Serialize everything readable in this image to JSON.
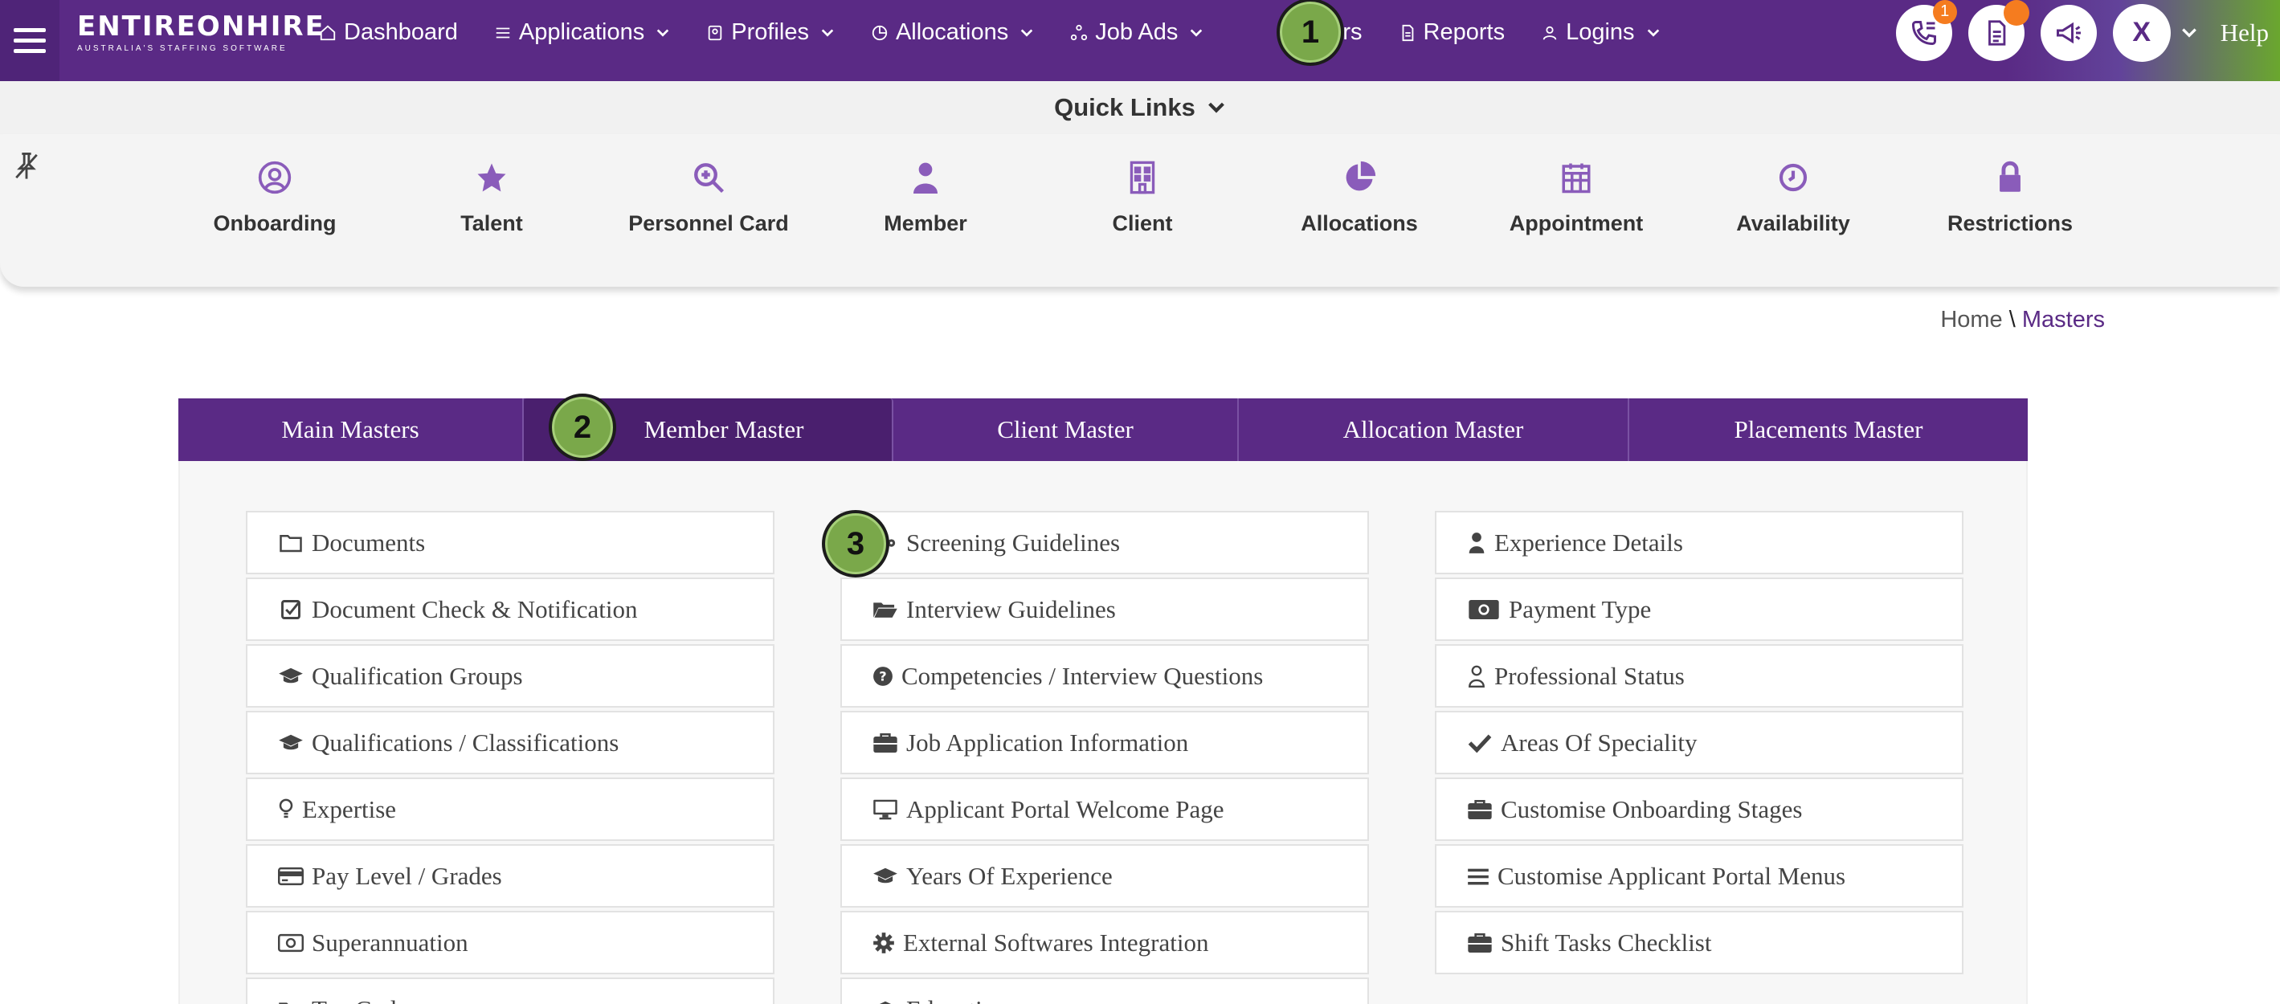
{
  "logo": {
    "brand": "ENTIREONHIRE",
    "tagline": "AUSTRALIA'S STAFFING SOFTWARE"
  },
  "nav": {
    "items": [
      {
        "label": "Dashboard",
        "icon": "home-icon"
      },
      {
        "label": "Applications",
        "icon": "list-icon"
      },
      {
        "label": "Profiles",
        "icon": "id-card-icon"
      },
      {
        "label": "Allocations",
        "icon": "pie-icon"
      },
      {
        "label": "Job Ads",
        "icon": "share-icon"
      },
      {
        "label": "Masters",
        "icon": "grid-icon"
      },
      {
        "label": "Reports",
        "icon": "file-icon"
      },
      {
        "label": "Logins",
        "icon": "user-icon"
      }
    ],
    "notification_count": "1",
    "user_initial": "X",
    "help": "Help"
  },
  "quick_links": {
    "title": "Quick Links",
    "items": [
      {
        "label": "Onboarding",
        "icon": "user-circle-icon"
      },
      {
        "label": "Talent",
        "icon": "star-icon"
      },
      {
        "label": "Personnel Card",
        "icon": "search-plus-icon"
      },
      {
        "label": "Member",
        "icon": "person-icon"
      },
      {
        "label": "Client",
        "icon": "building-icon"
      },
      {
        "label": "Allocations",
        "icon": "pie-chart-icon"
      },
      {
        "label": "Appointment",
        "icon": "calendar-icon"
      },
      {
        "label": "Availability",
        "icon": "clock-icon"
      },
      {
        "label": "Restrictions",
        "icon": "lock-icon"
      }
    ]
  },
  "breadcrumb": {
    "home": "Home",
    "separator": "\\",
    "current": "Masters"
  },
  "tabs": [
    "Main Masters",
    "Member Master",
    "Client Master",
    "Allocation Master",
    "Placements Master"
  ],
  "active_tab": "Member Master",
  "columns": [
    [
      {
        "label": "Documents",
        "icon": "folder-icon"
      },
      {
        "label": "Document Check & Notification",
        "icon": "check-square-icon"
      },
      {
        "label": "Qualification Groups",
        "icon": "graduation-cap-icon"
      },
      {
        "label": "Qualifications / Classifications",
        "icon": "graduation-cap-icon"
      },
      {
        "label": "Expertise",
        "icon": "lightbulb-icon"
      },
      {
        "label": "Pay Level / Grades",
        "icon": "credit-card-icon"
      },
      {
        "label": "Superannuation",
        "icon": "money-icon"
      },
      {
        "label": "Tax Codes",
        "icon": "folder-open-icon"
      }
    ],
    [
      {
        "label": "Screening Guidelines",
        "icon": "sitemap-icon"
      },
      {
        "label": "Interview Guidelines",
        "icon": "folder-open-icon"
      },
      {
        "label": "Competencies / Interview Questions",
        "icon": "question-circle-icon"
      },
      {
        "label": "Job Application Information",
        "icon": "briefcase-icon"
      },
      {
        "label": "Applicant Portal Welcome Page",
        "icon": "desktop-icon"
      },
      {
        "label": "Years Of Experience",
        "icon": "graduation-cap-icon"
      },
      {
        "label": "External Softwares Integration",
        "icon": "gear-icon"
      },
      {
        "label": "Education",
        "icon": "graduation-cap-icon"
      }
    ],
    [
      {
        "label": "Experience Details",
        "icon": "person-icon"
      },
      {
        "label": "Payment Type",
        "icon": "money-icon"
      },
      {
        "label": "Professional Status",
        "icon": "user-outline-icon"
      },
      {
        "label": "Areas Of Speciality",
        "icon": "check-icon"
      },
      {
        "label": "Customise Onboarding Stages",
        "icon": "briefcase-icon"
      },
      {
        "label": "Customise Applicant Portal Menus",
        "icon": "bars-icon"
      },
      {
        "label": "Shift Tasks Checklist",
        "icon": "briefcase-icon"
      }
    ]
  ],
  "steps": [
    "1",
    "2",
    "3"
  ],
  "colors": {
    "primary": "#5a2a85",
    "accent_green": "#7aa84a",
    "badge": "#f57c1f"
  }
}
